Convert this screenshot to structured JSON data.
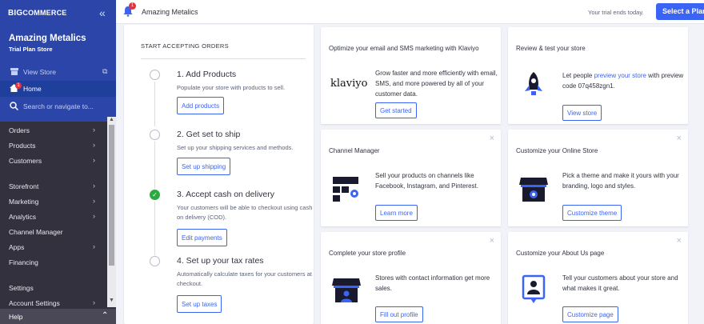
{
  "sidebar": {
    "logo_prefix": "BIG",
    "logo_suffix": "COMMERCE",
    "collapse_icon": "«",
    "store_name": "Amazing Metalics",
    "store_plan": "Trial Plan Store",
    "view_store": "View Store",
    "home": "Home",
    "home_badge": "1",
    "search_placeholder": "Search or navigate to...",
    "nav": [
      "Orders",
      "Products",
      "Customers",
      "Storefront",
      "Marketing",
      "Analytics",
      "Channel Manager",
      "Apps",
      "Financing",
      "Settings",
      "Account Settings"
    ],
    "help": "Help",
    "brand_color": "#2b46a8",
    "bg_color": "#34313f"
  },
  "topbar": {
    "notification_count": "1",
    "store_name": "Amazing Metalics",
    "trial_text": "Your trial ends today.",
    "plan_button": "Select a Plan"
  },
  "orders_card": {
    "title": "START ACCEPTING ORDERS",
    "steps": [
      {
        "title": "1. Add Products",
        "desc": "Populate your store with products to sell.",
        "button": "Add products",
        "done": false
      },
      {
        "title": "2. Get set to ship",
        "desc": "Set up your shipping services and methods.",
        "button": "Set up shipping",
        "done": false
      },
      {
        "title": "3. Accept cash on delivery",
        "desc": "Your customers will be able to checkout using cash on delivery (COD).",
        "button": "Edit payments",
        "done": true
      },
      {
        "title": "4. Set up your tax rates",
        "desc": "Automatically calculate taxes for your customers at checkout.",
        "button": "Set up taxes",
        "done": false
      }
    ]
  },
  "cards": {
    "klaviyo": {
      "title": "Optimize your email and SMS marketing with Klaviyo",
      "logo": "klaviyo",
      "body": "Grow faster and more efficiently with email, SMS, and more powered by all of your customer data.",
      "button": "Get started"
    },
    "review": {
      "title": "Review & test your store",
      "body_pre": "Let people ",
      "body_link": "preview your store",
      "body_post": " with preview code 07q458zgn1.",
      "button": "View store"
    },
    "channel": {
      "title": "Channel Manager",
      "body": "Sell your products on channels like Facebook, Instagram, and Pinterest.",
      "button": "Learn more"
    },
    "customize": {
      "title": "Customize your Online Store",
      "body": "Pick a theme and make it yours with your branding, logo and styles.",
      "button": "Customize theme"
    },
    "profile": {
      "title": "Complete your store profile",
      "body": "Stores with contact information get more sales.",
      "button": "Fill out profile"
    },
    "about": {
      "title": "Customize your About Us page",
      "body": "Tell your customers about your store and what makes it great.",
      "button": "Customize page"
    },
    "close_icon": "×"
  }
}
